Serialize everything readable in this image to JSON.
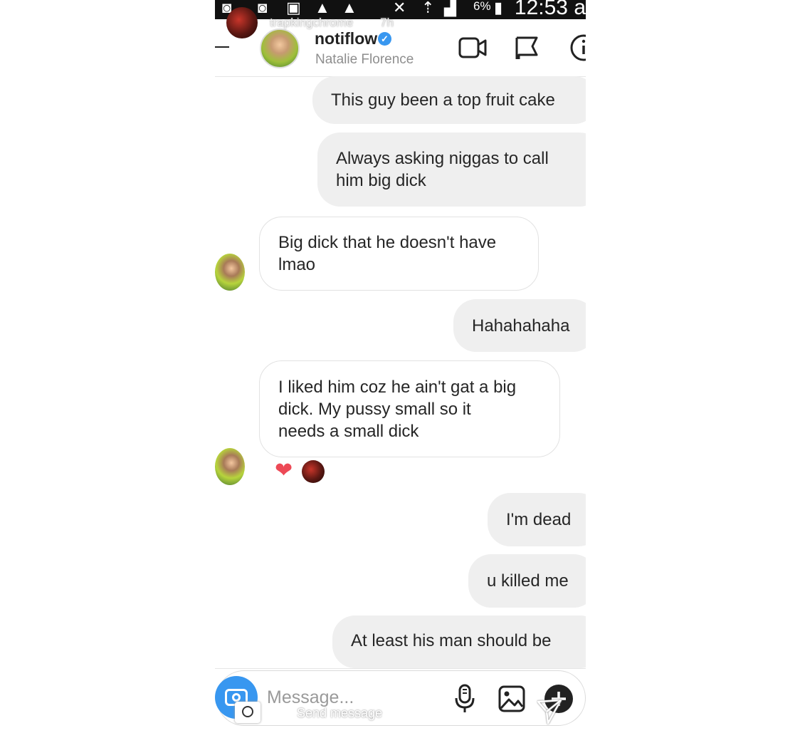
{
  "status_bar": {
    "battery": "6%",
    "time": "12:53 a"
  },
  "story_overlay": {
    "username": "trapkingchrome",
    "time_ago": "7h"
  },
  "header": {
    "username": "notiflow",
    "subtitle": "Natalie Florence",
    "icons": [
      "video-call-icon",
      "flag-icon",
      "info-icon"
    ]
  },
  "messages": [
    {
      "side": "out",
      "text": "This guy been a top fruit cake"
    },
    {
      "side": "out",
      "text": "Always asking niggas to call\nhim big dick"
    },
    {
      "side": "in",
      "text": "Big dick that he doesn't have\nlmao"
    },
    {
      "side": "out",
      "text": "Hahahahaha"
    },
    {
      "side": "in",
      "text": "I liked him coz he ain't gat a big\ndick. My pussy small so it\nneeds a small dick",
      "reaction": "heart"
    },
    {
      "side": "out",
      "text": "I'm dead"
    },
    {
      "side": "out",
      "text": "u killed me"
    },
    {
      "side": "out",
      "text": "At least his man should be"
    }
  ],
  "composer": {
    "placeholder": "Message...",
    "send_overlay_label": "Send message"
  },
  "colors": {
    "accent_blue": "#3897f0",
    "heart_red": "#ed4956",
    "outgoing_bubble": "#efefef"
  }
}
